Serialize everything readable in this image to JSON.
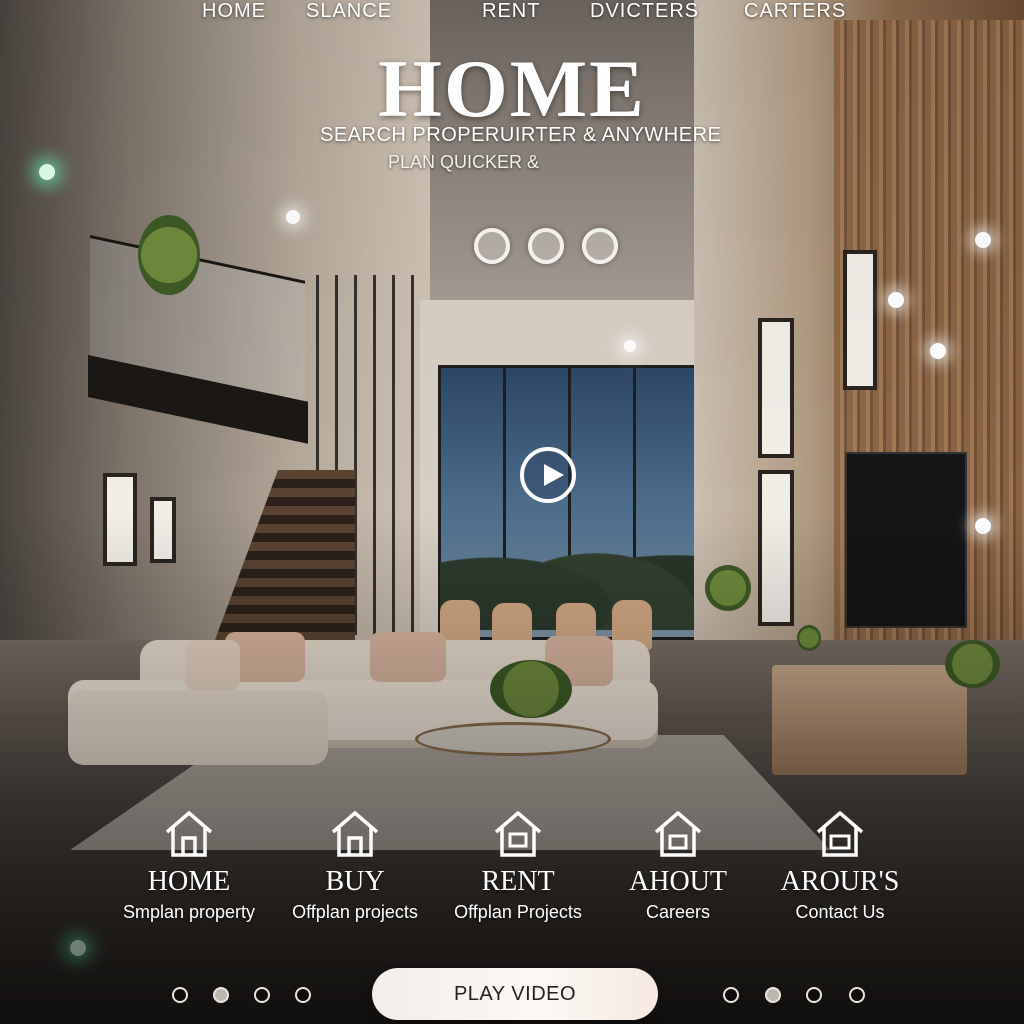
{
  "nav": {
    "items": [
      "HOME",
      "SLANCE",
      "RENT",
      "DVICTERS",
      "CARTERS"
    ]
  },
  "hero": {
    "title": "HOME",
    "subtitle": "SEARCH PROPERUIRTER & ANYWHERE",
    "subtitle2": "PLAN QUICKER &"
  },
  "categories": [
    {
      "title": "HOME",
      "link": "Smplan property",
      "icon": "house-icon"
    },
    {
      "title": "BUY",
      "link": "Offplan projects",
      "icon": "house-icon"
    },
    {
      "title": "RENT",
      "link": "Offplan Projects",
      "icon": "house-icon"
    },
    {
      "title": "AHOUT",
      "link": "Careers",
      "icon": "house-icon"
    },
    {
      "title": "AROUR'S",
      "link": "Contact Us",
      "icon": "house-icon"
    }
  ],
  "cta": {
    "play_video": "PLAY VIDEO"
  },
  "slider": {
    "dots": 3
  },
  "colors": {
    "text": "#ffffff",
    "button_bg": "#f7f3ef",
    "button_text": "#222222"
  }
}
